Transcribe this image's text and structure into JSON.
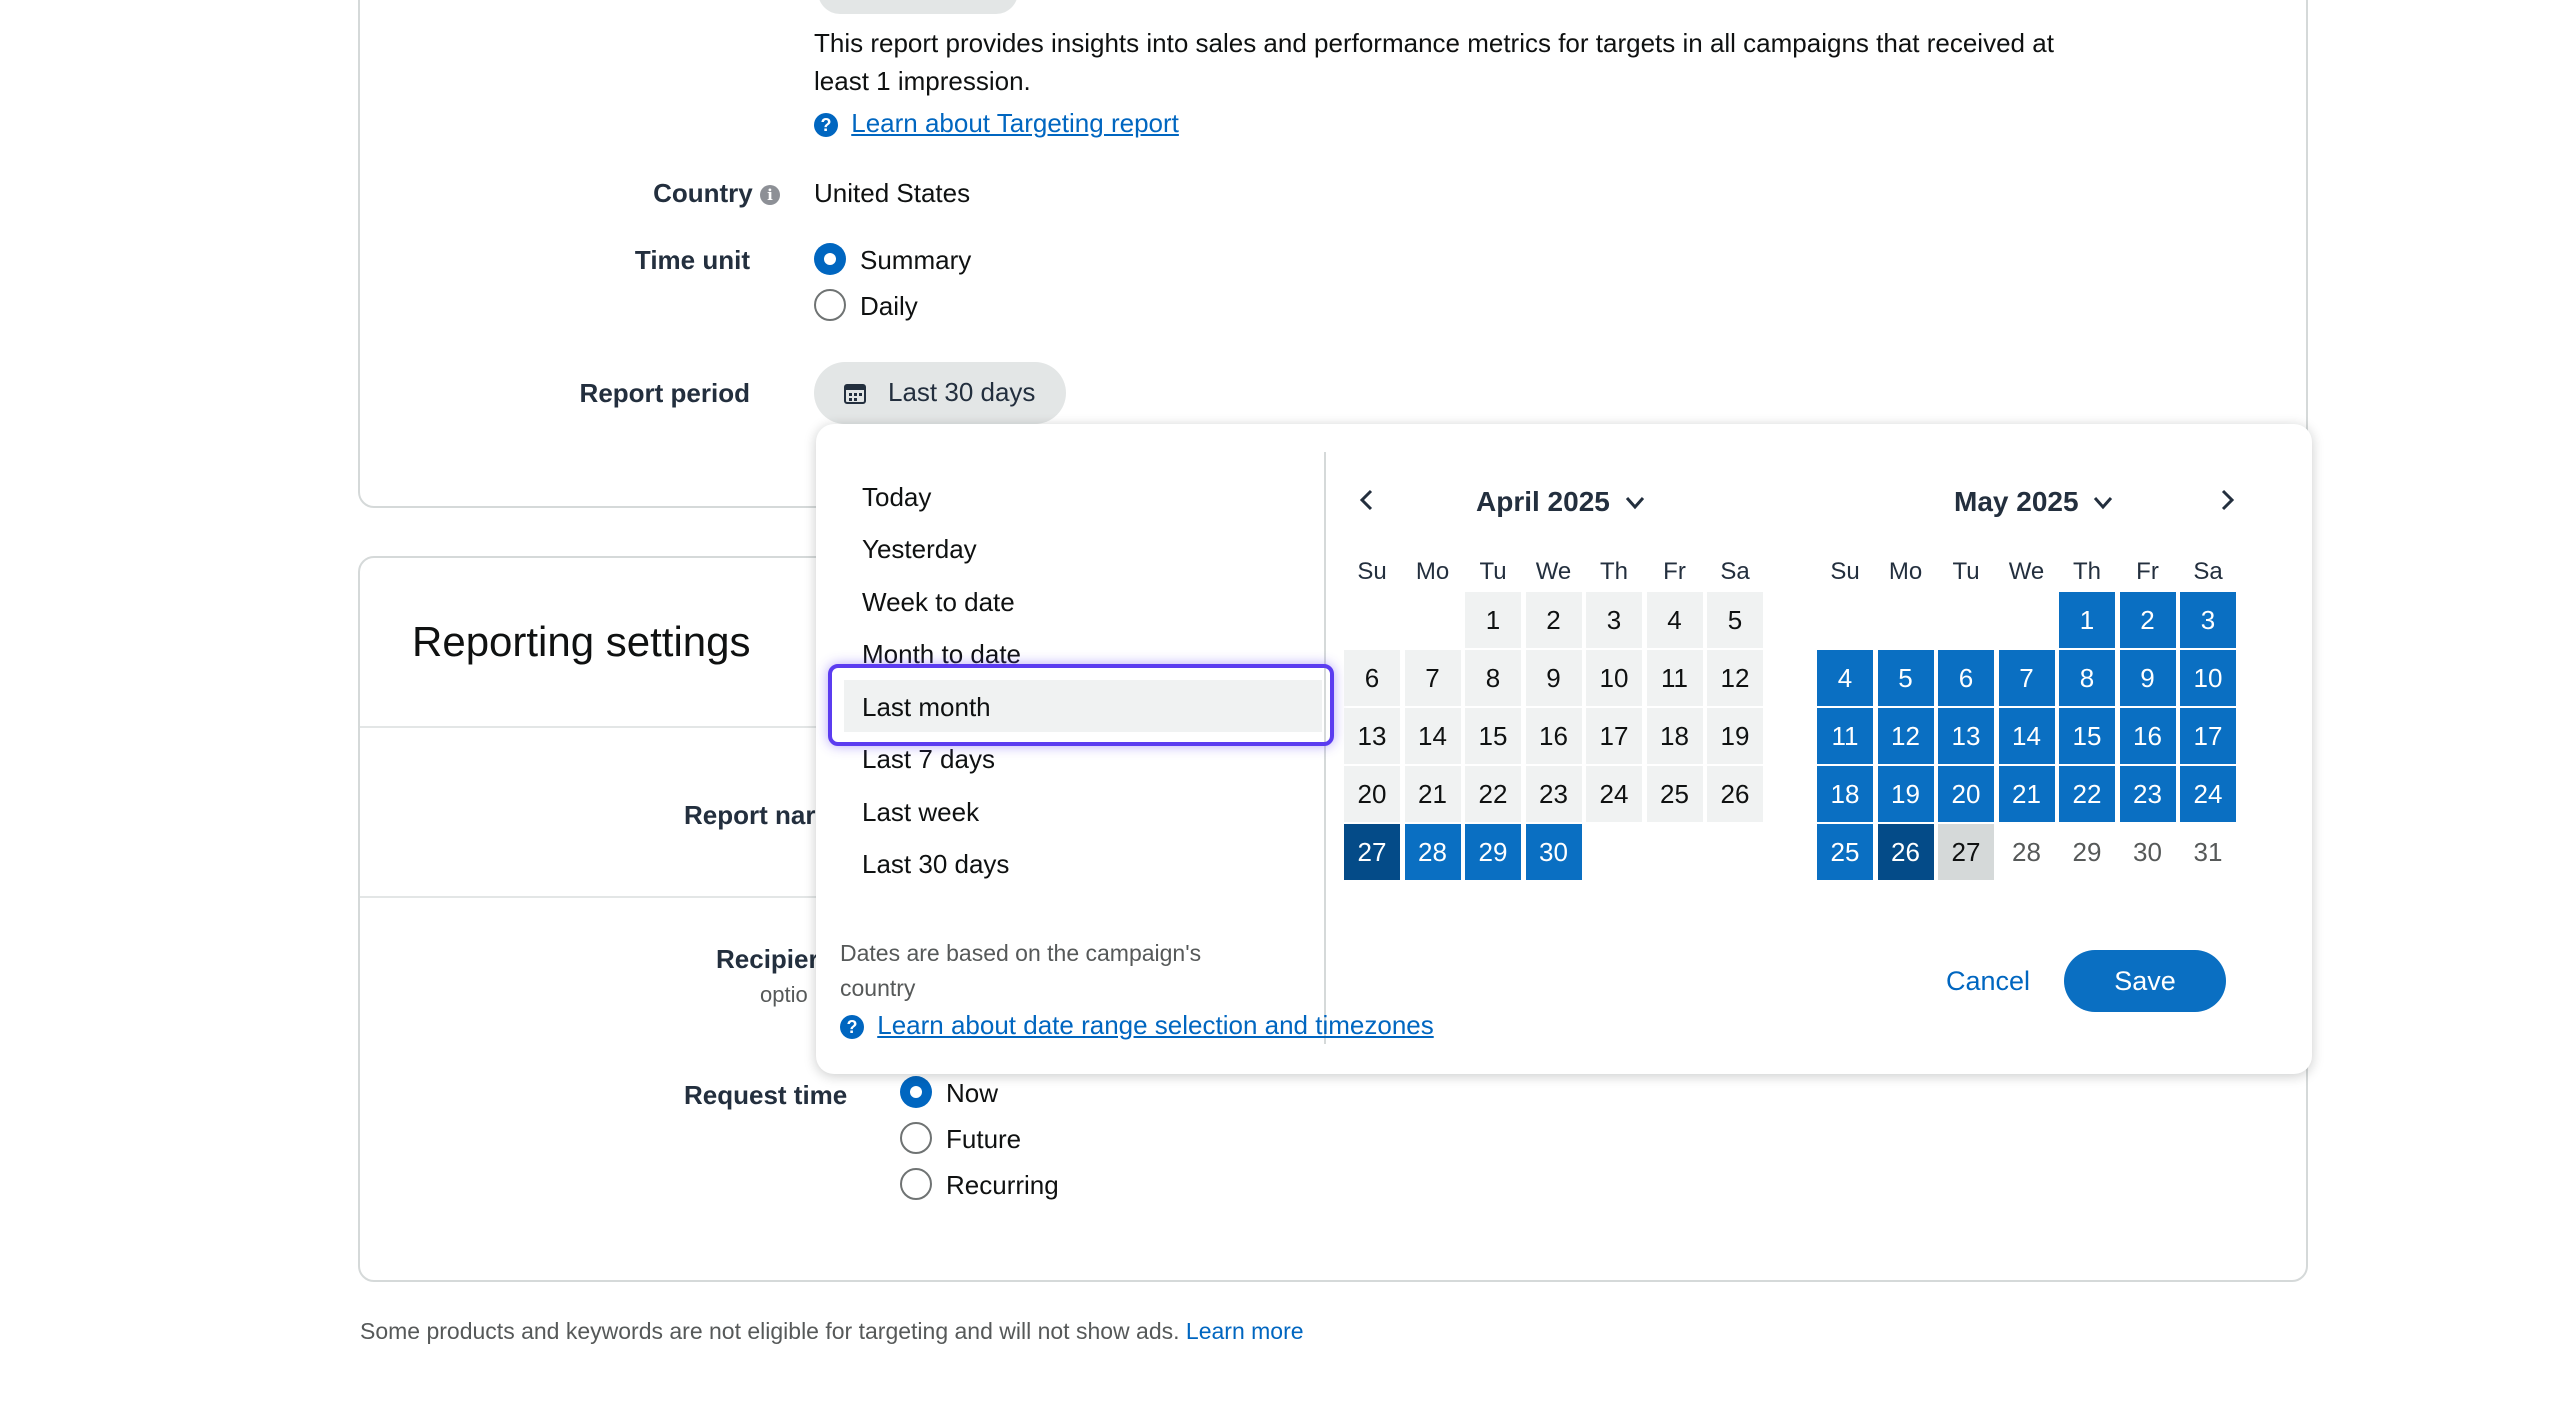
{
  "report_description": {
    "text": "This report provides insights into sales and performance metrics for targets in all campaigns that received at",
    "text_line2": "least 1 impression.",
    "learn_link": "Learn about Targeting report"
  },
  "country": {
    "label": "Country",
    "value": "United States"
  },
  "time_unit": {
    "label": "Time unit",
    "options": [
      "Summary",
      "Daily"
    ],
    "selected": "Summary"
  },
  "report_period": {
    "label": "Report period",
    "button": "Last 30 days"
  },
  "reporting_settings": {
    "title": "Reporting settings",
    "report_name_label": "Report nar",
    "recipients_label": "Recipier",
    "recipients_sub": "optio",
    "request_time_label": "Request time",
    "request_time_options": [
      "Now",
      "Future",
      "Recurring"
    ],
    "request_time_selected": "Now"
  },
  "footer_note": {
    "text": "Some products and keywords are not eligible for targeting and will not show ads.",
    "link": "Learn more"
  },
  "date_picker": {
    "presets": [
      "Today",
      "Yesterday",
      "Week to date",
      "Month to date",
      "Last month",
      "Last 7 days",
      "Last week",
      "Last 30 days"
    ],
    "highlighted_preset": "Last month",
    "note_line1": "Dates are based on the campaign's",
    "note_line2": "country",
    "note_link": "Learn about date range selection and timezones",
    "weekdays": [
      "Su",
      "Mo",
      "Tu",
      "We",
      "Th",
      "Fr",
      "Sa"
    ],
    "months": [
      {
        "title": "April 2025",
        "weeks": [
          [
            "",
            "",
            "1",
            "2",
            "3",
            "4",
            "5"
          ],
          [
            "6",
            "7",
            "8",
            "9",
            "10",
            "11",
            "12"
          ],
          [
            "13",
            "14",
            "15",
            "16",
            "17",
            "18",
            "19"
          ],
          [
            "20",
            "21",
            "22",
            "23",
            "24",
            "25",
            "26"
          ],
          [
            "27",
            "28",
            "29",
            "30",
            "",
            "",
            ""
          ]
        ],
        "range_start": 27,
        "range_end": 31,
        "range_start_marker": 27
      },
      {
        "title": "May 2025",
        "weeks": [
          [
            "",
            "",
            "",
            "",
            "1",
            "2",
            "3"
          ],
          [
            "4",
            "5",
            "6",
            "7",
            "8",
            "9",
            "10"
          ],
          [
            "11",
            "12",
            "13",
            "14",
            "15",
            "16",
            "17"
          ],
          [
            "18",
            "19",
            "20",
            "21",
            "22",
            "23",
            "24"
          ],
          [
            "25",
            "26",
            "27",
            "28",
            "29",
            "30",
            "31"
          ]
        ],
        "range_start": 1,
        "range_end": 26,
        "range_end_marker": 26,
        "today": 27
      }
    ],
    "cancel_label": "Cancel",
    "save_label": "Save"
  },
  "colors": {
    "accent": "#0066c0",
    "selected_day": "#0a6fc2",
    "range_endpoint": "#044b88",
    "focus_ring": "#5b3cf0"
  }
}
